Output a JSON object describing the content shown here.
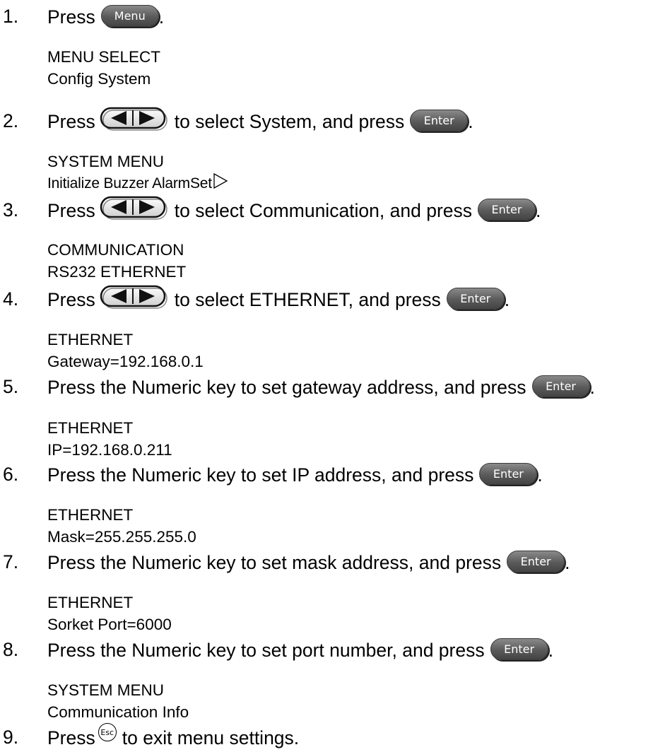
{
  "steps": [
    {
      "num": "1.",
      "parts": [
        "Press",
        ""
      ],
      "end": ".",
      "keys": {
        "menu": "Menu"
      },
      "lcd": [
        "MENU SELECT",
        "Config System"
      ]
    },
    {
      "num": "2.",
      "pre": "Press",
      "mid": "to select System, and press",
      "end": "."
    },
    {
      "num": "3.",
      "pre": "Press",
      "mid": "to select Communication, and press",
      "end": "."
    },
    {
      "num": "4.",
      "pre": "Press",
      "mid": "to select ETHERNET, and press",
      "end": "."
    },
    {
      "num": "5.",
      "text": "Press the Numeric key to set gateway address, and press",
      "end": "."
    },
    {
      "num": "6.",
      "text": "Press the Numeric key to set IP address, and press",
      "end": "."
    },
    {
      "num": "7.",
      "text": "Press the Numeric key to set mask address, and press",
      "end": "."
    },
    {
      "num": "8.",
      "text": "Press the Numeric key to set port number, and press",
      "end": "."
    },
    {
      "num": "9.",
      "pre": "Press",
      "mid": "to exit menu settings."
    }
  ],
  "keys": {
    "menu": "Menu",
    "enter": "Enter",
    "esc": "Esc",
    "arrows_icon": "left-right-arrow-keys-icon",
    "submenu_icon": "triangle-right-icon"
  },
  "lcd": [
    [
      "MENU SELECT",
      "Config System"
    ],
    [
      "SYSTEM MENU",
      "Initialize Buzzer AlarmSet"
    ],
    [
      "COMMUNICATION",
      "RS232 ETHERNET"
    ],
    [
      "ETHERNET",
      "Gateway=192.168.0.1"
    ],
    [
      "ETHERNET",
      "IP=192.168.0.211"
    ],
    [
      "ETHERNET",
      "Mask=255.255.255.0"
    ],
    [
      "ETHERNET",
      "Sorket Port=6000"
    ],
    [
      "SYSTEM MENU",
      "Communication Info"
    ]
  ]
}
